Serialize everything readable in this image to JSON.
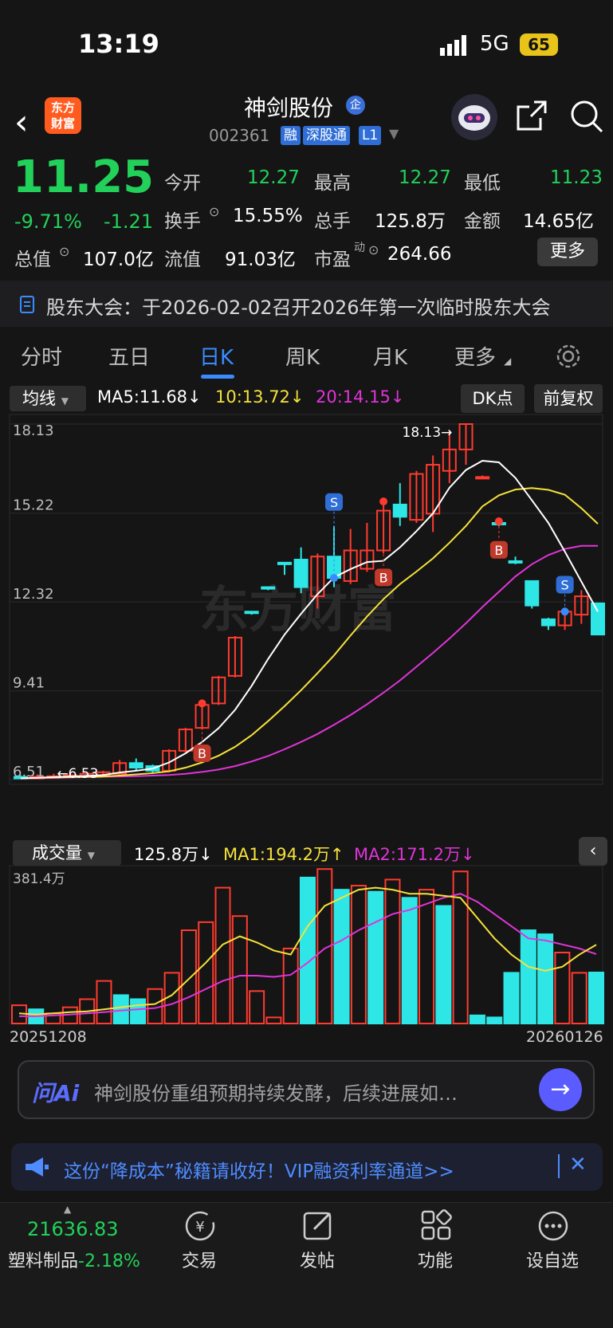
{
  "status": {
    "time": "13:19",
    "network": "5G",
    "battery": "65"
  },
  "header": {
    "stock_name": "神剑股份",
    "qi_badge": "企",
    "code": "002361",
    "tags": [
      "融",
      "深股通",
      "L1"
    ],
    "logo_text_line1": "东方",
    "logo_text_line2": "财富"
  },
  "quote": {
    "price": "11.25",
    "pct_change": "-9.71%",
    "change": "-1.21",
    "total_value_label": "总值",
    "total_value": "107.0亿",
    "open_label": "今开",
    "open": "12.27",
    "high_label": "最高",
    "high": "12.27",
    "low_label": "最低",
    "low": "11.23",
    "turnover_label": "换手",
    "turnover": "15.55%",
    "volume_label": "总手",
    "volume": "125.8万",
    "amount_label": "金额",
    "amount": "14.65亿",
    "float_value_label": "流值",
    "float_value": "91.03亿",
    "pe_label": "市盈",
    "pe_sup": "动",
    "pe": "264.66",
    "more_label": "更多"
  },
  "notice": {
    "text": "股东大会：于2026-02-02召开2026年第一次临时股东大会"
  },
  "tabs": {
    "items": [
      "分时",
      "五日",
      "日K",
      "周K",
      "月K",
      "更多"
    ],
    "active_index": 2
  },
  "indicators": {
    "ma_select": "均线",
    "ma5": "MA5:11.68↓",
    "ma10": "10:13.72↓",
    "ma20": "20:14.15↓",
    "dk_label": "DK点",
    "adjust_label": "前复权"
  },
  "volume_panel": {
    "select": "成交量",
    "vol": "125.8万↓",
    "ma1": "MA1:194.2万↑",
    "ma2": "MA2:171.2万↓",
    "max_label": "381.4万",
    "start_date": "20251208",
    "end_date": "20260126"
  },
  "chart_data": [
    {
      "type": "candlestick",
      "y_ticks": [
        "18.13",
        "15.22",
        "12.32",
        "9.41",
        "6.51"
      ],
      "ylim": [
        6.51,
        18.13
      ],
      "high_marker": "18.13→",
      "low_marker": "←6.53",
      "watermark": "东方财富",
      "signals": [
        {
          "type": "S",
          "index": 19
        },
        {
          "type": "B",
          "index": 11
        },
        {
          "type": "B",
          "index": 22
        },
        {
          "type": "B",
          "index": 29
        },
        {
          "type": "S",
          "index": 33
        }
      ],
      "candles": [
        {
          "o": 6.6,
          "c": 6.55,
          "h": 6.65,
          "l": 6.53
        },
        {
          "o": 6.58,
          "c": 6.6,
          "h": 6.68,
          "l": 6.53
        },
        {
          "o": 6.6,
          "c": 6.62,
          "h": 6.7,
          "l": 6.55
        },
        {
          "o": 6.6,
          "c": 6.65,
          "h": 6.72,
          "l": 6.55
        },
        {
          "o": 6.62,
          "c": 6.7,
          "h": 6.75,
          "l": 6.58
        },
        {
          "o": 6.65,
          "c": 6.75,
          "h": 6.8,
          "l": 6.6
        },
        {
          "o": 6.7,
          "c": 7.05,
          "h": 7.15,
          "l": 6.65
        },
        {
          "o": 7.05,
          "c": 6.9,
          "h": 7.2,
          "l": 6.8
        },
        {
          "o": 6.95,
          "c": 6.8,
          "h": 7.0,
          "l": 6.7
        },
        {
          "o": 6.8,
          "c": 7.45,
          "h": 7.5,
          "l": 6.75
        },
        {
          "o": 7.45,
          "c": 8.15,
          "h": 8.2,
          "l": 7.4
        },
        {
          "o": 8.2,
          "c": 8.95,
          "h": 9.0,
          "l": 8.15
        },
        {
          "o": 9.0,
          "c": 9.85,
          "h": 9.9,
          "l": 8.95
        },
        {
          "o": 9.9,
          "c": 11.15,
          "h": 11.2,
          "l": 9.85
        },
        {
          "o": 12.0,
          "c": 11.95,
          "h": 12.0,
          "l": 11.9
        },
        {
          "o": 12.8,
          "c": 12.75,
          "h": 12.8,
          "l": 12.7
        },
        {
          "o": 13.6,
          "c": 13.55,
          "h": 13.6,
          "l": 13.2
        },
        {
          "o": 13.7,
          "c": 12.8,
          "h": 14.1,
          "l": 12.6
        },
        {
          "o": 12.5,
          "c": 13.8,
          "h": 13.9,
          "l": 12.1
        },
        {
          "o": 13.8,
          "c": 13.1,
          "h": 14.8,
          "l": 12.8
        },
        {
          "o": 13.0,
          "c": 14.0,
          "h": 14.7,
          "l": 12.9
        },
        {
          "o": 13.4,
          "c": 14.0,
          "h": 14.9,
          "l": 13.3
        },
        {
          "o": 14.0,
          "c": 15.3,
          "h": 15.6,
          "l": 13.9
        },
        {
          "o": 15.5,
          "c": 15.1,
          "h": 16.2,
          "l": 14.8
        },
        {
          "o": 15.0,
          "c": 16.5,
          "h": 16.6,
          "l": 14.9
        },
        {
          "o": 15.2,
          "c": 16.8,
          "h": 17.1,
          "l": 14.6
        },
        {
          "o": 16.6,
          "c": 17.3,
          "h": 17.9,
          "l": 16.2
        },
        {
          "o": 17.3,
          "c": 18.13,
          "h": 18.13,
          "l": 16.8
        },
        {
          "o": 16.4,
          "c": 16.4,
          "h": 16.45,
          "l": 16.35
        },
        {
          "o": 14.9,
          "c": 14.85,
          "h": 14.95,
          "l": 14.8
        },
        {
          "o": 13.65,
          "c": 13.6,
          "h": 13.8,
          "l": 13.55
        },
        {
          "o": 13.0,
          "c": 12.2,
          "h": 13.0,
          "l": 12.1
        },
        {
          "o": 11.75,
          "c": 11.55,
          "h": 11.8,
          "l": 11.4
        },
        {
          "o": 11.55,
          "c": 12.0,
          "h": 12.1,
          "l": 11.4
        },
        {
          "o": 11.9,
          "c": 12.5,
          "h": 12.7,
          "l": 11.6
        },
        {
          "o": 12.27,
          "c": 11.25,
          "h": 12.27,
          "l": 11.23
        }
      ],
      "ma": {
        "ma5": [
          6.55,
          6.57,
          6.59,
          6.61,
          6.63,
          6.66,
          6.74,
          6.8,
          6.87,
          7.07,
          7.37,
          7.74,
          8.19,
          8.79,
          9.57,
          10.45,
          11.25,
          11.93,
          12.57,
          13.12,
          13.39,
          13.62,
          13.66,
          14.1,
          14.63,
          15.21,
          16.05,
          16.63,
          16.93,
          16.88,
          16.37,
          15.64,
          14.9,
          13.96,
          12.98,
          12.0
        ],
        "ma10": [
          6.55,
          6.57,
          6.58,
          6.59,
          6.6,
          6.61,
          6.64,
          6.68,
          6.72,
          6.78,
          6.9,
          7.07,
          7.29,
          7.58,
          7.96,
          8.42,
          8.91,
          9.43,
          9.99,
          10.57,
          11.22,
          11.84,
          12.41,
          12.9,
          13.31,
          13.74,
          14.25,
          14.8,
          15.44,
          15.8,
          15.99,
          16.04,
          15.98,
          15.82,
          15.38,
          14.87
        ],
        "ma20": [
          6.55,
          6.56,
          6.57,
          6.58,
          6.59,
          6.6,
          6.61,
          6.62,
          6.64,
          6.66,
          6.7,
          6.76,
          6.84,
          6.95,
          7.1,
          7.28,
          7.5,
          7.74,
          8.0,
          8.3,
          8.62,
          8.97,
          9.35,
          9.75,
          10.2,
          10.65,
          11.12,
          11.62,
          12.15,
          12.65,
          13.15,
          13.55,
          13.85,
          14.05,
          14.15,
          14.15
        ]
      }
    },
    {
      "type": "bar",
      "ylim": [
        0,
        381.4
      ],
      "unit": "万",
      "volumes": [
        45,
        35,
        25,
        40,
        60,
        105,
        70,
        60,
        85,
        125,
        230,
        250,
        335,
        265,
        80,
        15,
        185,
        360,
        381,
        330,
        340,
        325,
        355,
        310,
        330,
        290,
        375,
        20,
        15,
        125,
        230,
        220,
        175,
        125,
        125.8
      ],
      "colors": [
        "r",
        "c",
        "r",
        "r",
        "r",
        "r",
        "c",
        "c",
        "r",
        "r",
        "r",
        "r",
        "r",
        "r",
        "r",
        "r",
        "r",
        "c",
        "r",
        "c",
        "r",
        "c",
        "r",
        "c",
        "r",
        "c",
        "r",
        "c",
        "c",
        "c",
        "c",
        "c",
        "r",
        "r",
        "c"
      ],
      "ma1": [
        25,
        22,
        25,
        28,
        30,
        35,
        40,
        45,
        48,
        70,
        110,
        150,
        195,
        215,
        200,
        180,
        170,
        240,
        290,
        310,
        330,
        335,
        330,
        320,
        320,
        315,
        310,
        260,
        210,
        170,
        140,
        130,
        140,
        170,
        194.2
      ],
      "ma2": [
        18,
        18,
        20,
        22,
        25,
        28,
        32,
        35,
        38,
        48,
        65,
        85,
        105,
        118,
        118,
        115,
        120,
        150,
        185,
        205,
        230,
        250,
        270,
        280,
        295,
        310,
        320,
        300,
        270,
        240,
        210,
        205,
        195,
        185,
        171.2
      ]
    }
  ],
  "ai": {
    "logo": "问Ai",
    "text": "神剑股份重组预期持续发酵，后续进展如…"
  },
  "ad": {
    "text": "这份“降成本”秘籍请收好！VIP融资利率通道>>"
  },
  "bottom": {
    "index_value": "21636.83",
    "index_name": "塑料制品",
    "index_pct": "-2.18%",
    "items": [
      "交易",
      "发帖",
      "功能",
      "设自选"
    ]
  }
}
